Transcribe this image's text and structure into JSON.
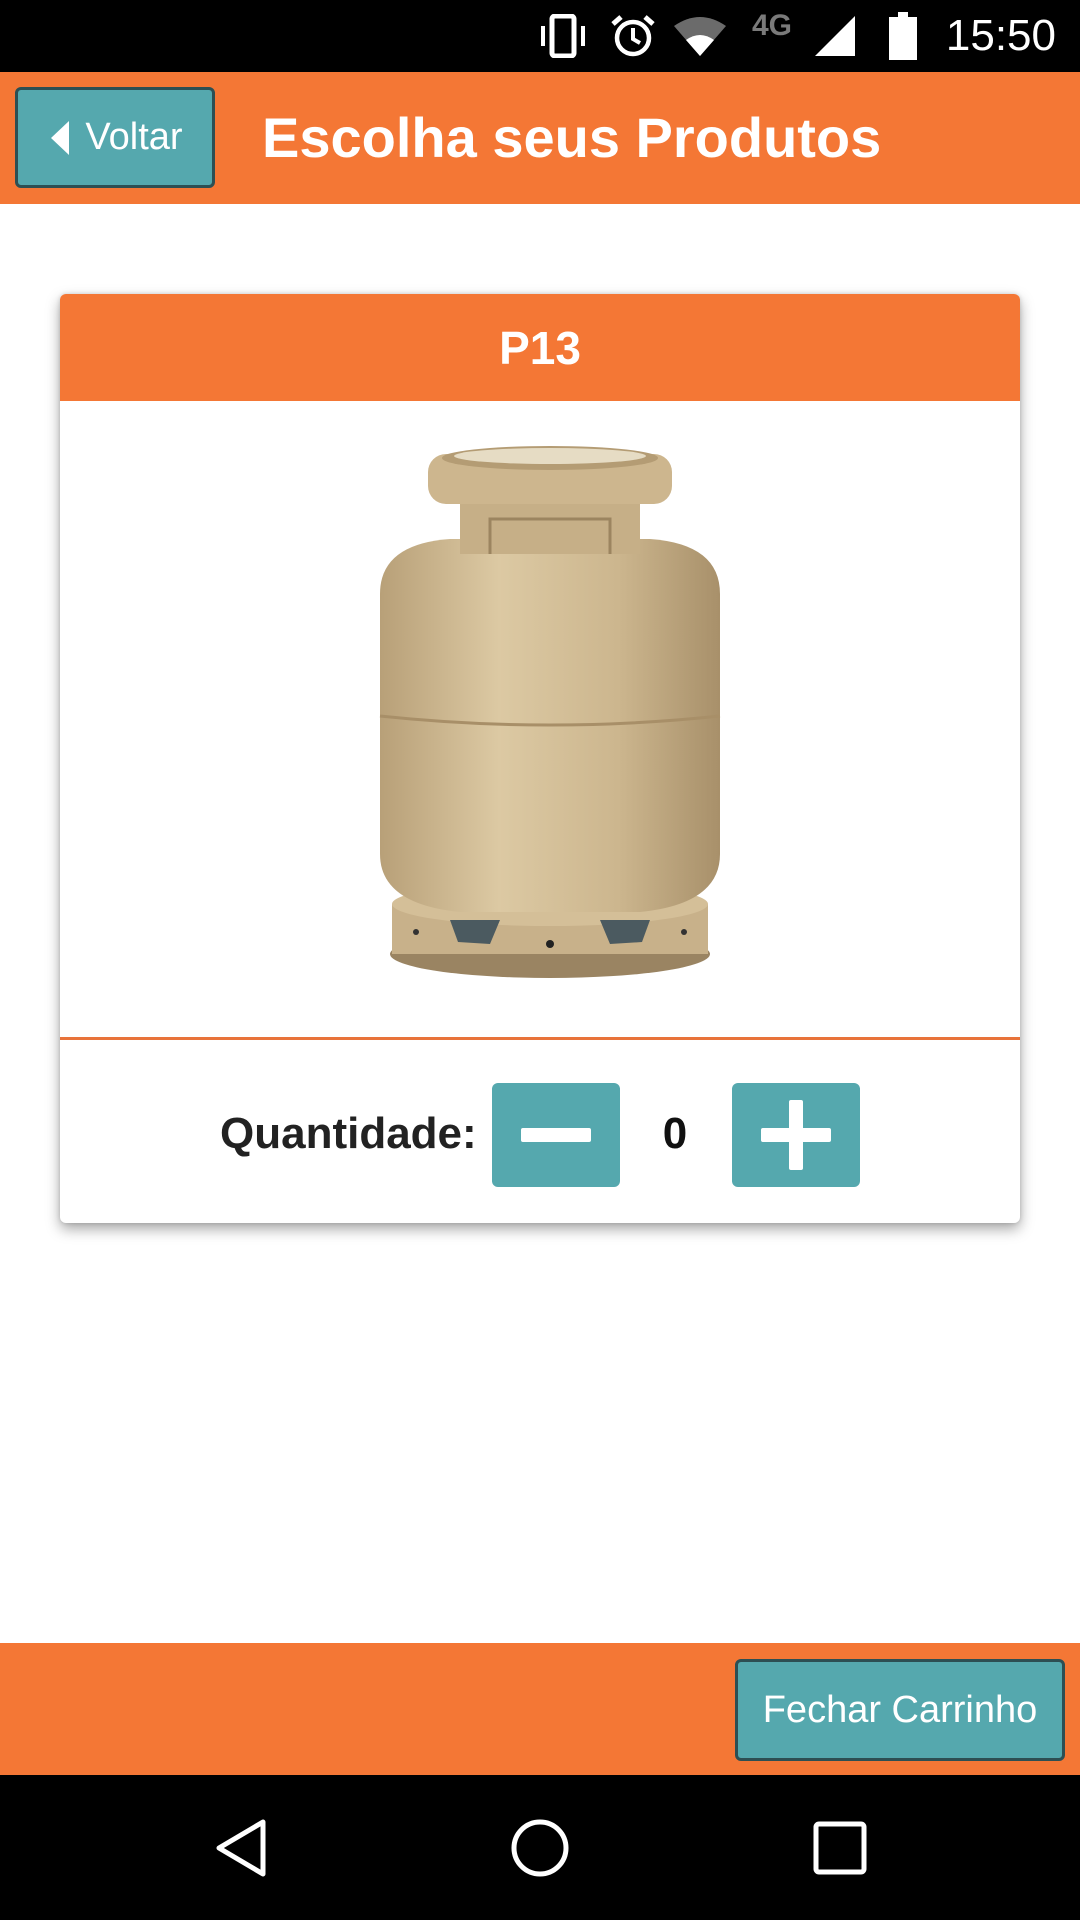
{
  "status_bar": {
    "time": "15:50",
    "network": "4G",
    "icons": [
      "vibrate-icon",
      "alarm-icon",
      "wifi-icon",
      "signal-icon",
      "battery-icon"
    ]
  },
  "header": {
    "back_label": "Voltar",
    "title": "Escolha seus Produtos"
  },
  "product": {
    "name": "P13",
    "image": "gas-cylinder-image",
    "quantity_label": "Quantidade:",
    "quantity": "0"
  },
  "footer": {
    "close_cart_label": "Fechar Carrinho"
  },
  "nav_bar": {
    "icons": [
      "back-triangle-icon",
      "home-circle-icon",
      "recents-square-icon"
    ]
  },
  "colors": {
    "accent": "#f47735",
    "button": "#55a8ae",
    "button_border": "#2d4f53"
  }
}
